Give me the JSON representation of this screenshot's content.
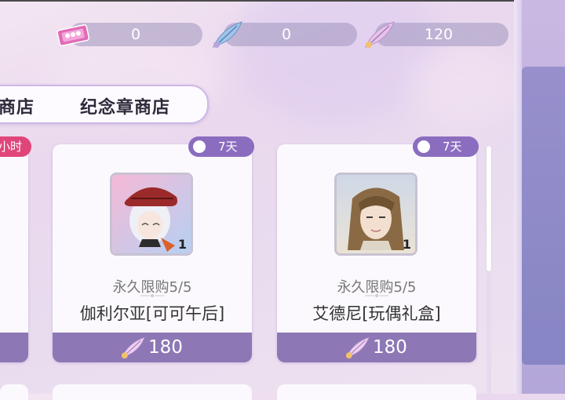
{
  "currencies": [
    {
      "icon": "ticket-icon",
      "value": "0"
    },
    {
      "icon": "blue-feather-icon",
      "value": "0"
    },
    {
      "icon": "rainbow-feather-icon",
      "value": "120"
    }
  ],
  "tabs": [
    {
      "label": "商店"
    },
    {
      "label": "纪念章商店"
    }
  ],
  "partial_card": {
    "badge": "小时"
  },
  "items": [
    {
      "name": "伽利尔亚[可可午后]",
      "limit": "永久限购5/5",
      "timer": "7天",
      "quantity": "1",
      "price": "180",
      "price_icon": "rainbow-feather-icon"
    },
    {
      "name": "艾德尼[玩偶礼盒]",
      "limit": "永久限购5/5",
      "timer": "7天",
      "quantity": "1",
      "price": "180",
      "price_icon": "rainbow-feather-icon"
    }
  ],
  "colors": {
    "accent": "#8b6dbf",
    "price_bar": "#8d77b4",
    "badge_red": "#e0457a"
  }
}
